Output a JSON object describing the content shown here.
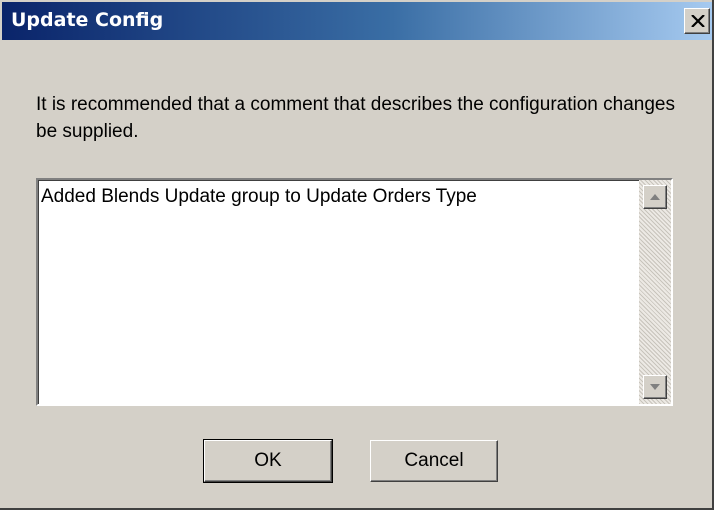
{
  "window": {
    "title": "Update Config",
    "close_label": "close"
  },
  "message": "It is recommended that a comment that describes the configuration changes be supplied.",
  "comment": {
    "value": "Added Blends Update group to Update Orders Type"
  },
  "buttons": {
    "ok_label": "OK",
    "cancel_label": "Cancel"
  },
  "colors": {
    "dialog_bg": "#d4d0c8",
    "titlebar_start": "#0a246a",
    "titlebar_end": "#a6caf0",
    "title_text": "#ffffff"
  },
  "icons": {
    "close": "close-icon",
    "scroll_up": "arrow-up-icon",
    "scroll_down": "arrow-down-icon"
  }
}
